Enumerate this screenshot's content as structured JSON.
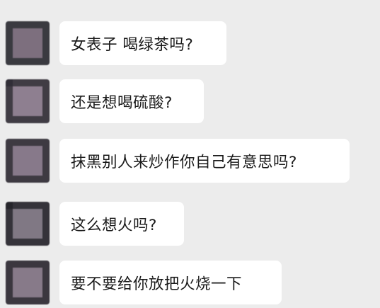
{
  "chat": {
    "messages": [
      {
        "text": "女表子 喝绿茶吗?",
        "width": 236
      },
      {
        "text": "还是想喝硫酸?",
        "width": 204
      },
      {
        "text": "抹黑别人来炒作你自己有意思吗?",
        "width": 410
      },
      {
        "text": "这么想火吗?",
        "width": 176
      },
      {
        "text": "要不要给你放把火烧一下",
        "width": 314
      }
    ]
  },
  "colors": {
    "background": "#ececec",
    "bubble": "#ffffff",
    "text": "#1a1a1a"
  }
}
